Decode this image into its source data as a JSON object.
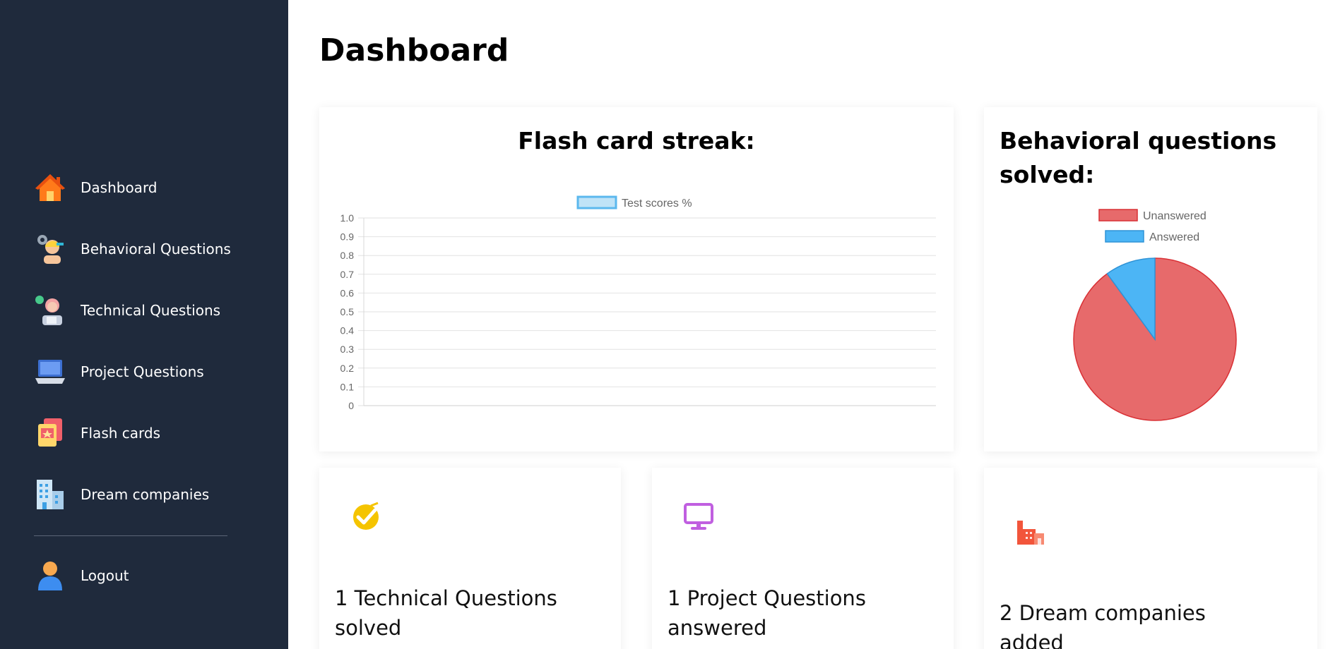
{
  "sidebar": {
    "items": [
      {
        "label": "Dashboard",
        "icon": "house-icon"
      },
      {
        "label": "Behavioral Questions",
        "icon": "person-gear-icon"
      },
      {
        "label": "Technical Questions",
        "icon": "support-agent-icon"
      },
      {
        "label": "Project Questions",
        "icon": "laptop-icon"
      },
      {
        "label": "Flash cards",
        "icon": "flash-cards-icon"
      },
      {
        "label": "Dream companies",
        "icon": "office-building-icon"
      }
    ],
    "logout": {
      "label": "Logout",
      "icon": "user-icon"
    }
  },
  "page": {
    "title": "Dashboard"
  },
  "streak_card": {
    "title": "Flash card streak:"
  },
  "behavioral_card": {
    "title": "Behavioral questions solved:"
  },
  "stats": [
    {
      "text": "1 Technical Questions solved",
      "icon": "check-badge-icon",
      "icon_bg": "#fff8d6",
      "icon_color": "#f5c400"
    },
    {
      "text": "1 Project Questions answered",
      "icon": "monitor-icon",
      "icon_bg": "#f6e2fb",
      "icon_color": "#c05fe0"
    },
    {
      "text": "2 Dream companies added",
      "icon": "factory-icon",
      "icon_bg": "#fde3e0",
      "icon_color": "#f2553b"
    }
  ],
  "chart_data": [
    {
      "type": "bar",
      "title": "",
      "series": [
        {
          "name": "Test scores %",
          "values": [],
          "color": "#bfe3f7",
          "border": "#5bb8ee"
        }
      ],
      "categories": [],
      "ylim": [
        0,
        1.0
      ],
      "yticks": [
        "0",
        "0.1",
        "0.2",
        "0.3",
        "0.4",
        "0.5",
        "0.6",
        "0.7",
        "0.8",
        "0.9",
        "1.0"
      ],
      "grid": true,
      "legend": "top"
    },
    {
      "type": "pie",
      "title": "",
      "labels": [
        "Unanswered",
        "Answered"
      ],
      "values": [
        9,
        1
      ],
      "colors": [
        "#e76a6b",
        "#4cb5f5"
      ],
      "borders": [
        "#d93035",
        "#2f93d6"
      ],
      "legend": "top"
    }
  ]
}
